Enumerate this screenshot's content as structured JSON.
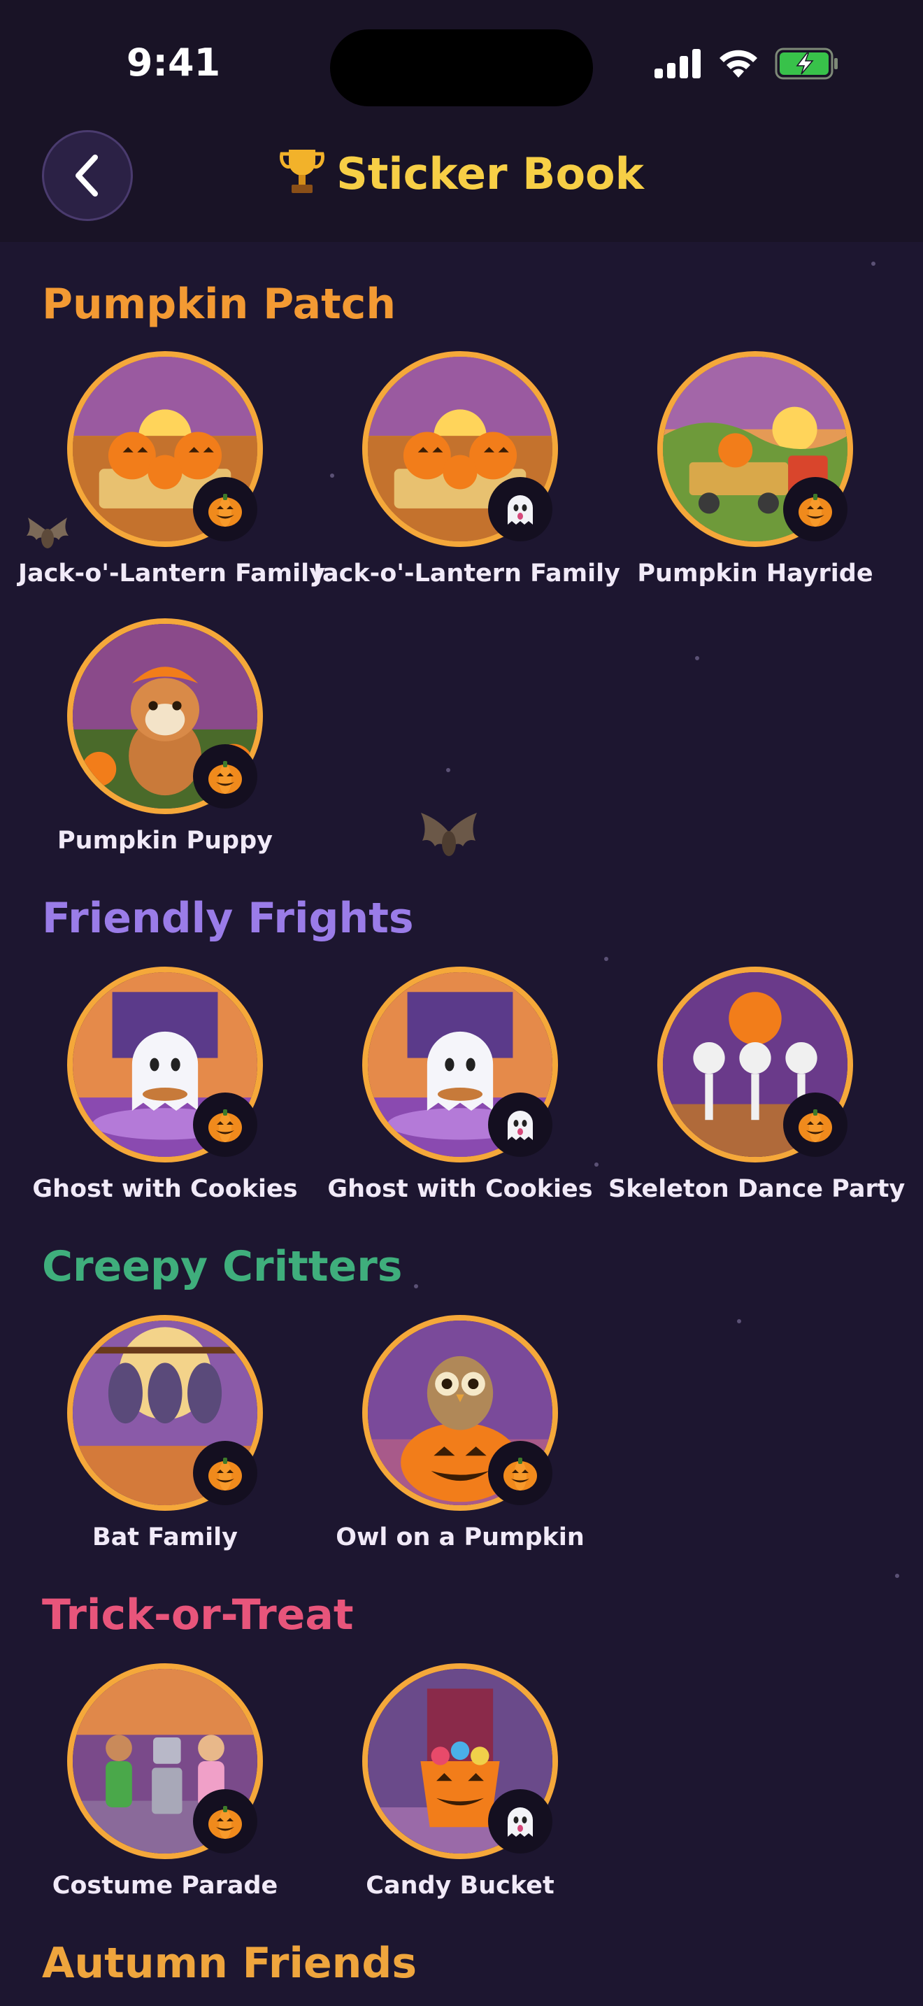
{
  "status_bar": {
    "time": "9:41"
  },
  "header": {
    "title": "Sticker Book",
    "trophy_icon": "trophy-icon",
    "back_icon": "chevron-left-icon"
  },
  "colors": {
    "background": "#1d1630",
    "header_bg": "#191326",
    "title": "#f7cf46",
    "ring": "#f5a83a",
    "pumpkin_patch": "#f39a33",
    "friendly_frights": "#9a7ce8",
    "creepy_critters": "#3fae7c",
    "trick_or_treat": "#e8557b",
    "autumn_friends": "#efa53d"
  },
  "sections": {
    "pumpkin_patch": {
      "title": "Pumpkin Patch",
      "items": [
        {
          "label": "Jack-o'-Lantern Family",
          "badge": "pumpkin-icon"
        },
        {
          "label": "Jack-o'-Lantern Family",
          "badge": "ghost-icon"
        },
        {
          "label": "Pumpkin Hayride",
          "badge": "pumpkin-icon"
        },
        {
          "label": "Pumpkin Puppy",
          "badge": "pumpkin-icon"
        }
      ]
    },
    "friendly_frights": {
      "title": "Friendly Frights",
      "items": [
        {
          "label": "Ghost with Cookies",
          "badge": "pumpkin-icon"
        },
        {
          "label": "Ghost with Cookies",
          "badge": "ghost-icon"
        },
        {
          "label": "Skeleton Dance Party",
          "badge": "pumpkin-icon"
        }
      ]
    },
    "creepy_critters": {
      "title": "Creepy Critters",
      "items": [
        {
          "label": "Bat Family",
          "badge": "pumpkin-icon"
        },
        {
          "label": "Owl on a Pumpkin",
          "badge": "pumpkin-icon"
        }
      ]
    },
    "trick_or_treat": {
      "title": "Trick-or-Treat",
      "items": [
        {
          "label": "Costume Parade",
          "badge": "pumpkin-icon"
        },
        {
          "label": "Candy Bucket",
          "badge": "ghost-icon"
        }
      ]
    },
    "autumn_friends": {
      "title": "Autumn Friends"
    }
  }
}
